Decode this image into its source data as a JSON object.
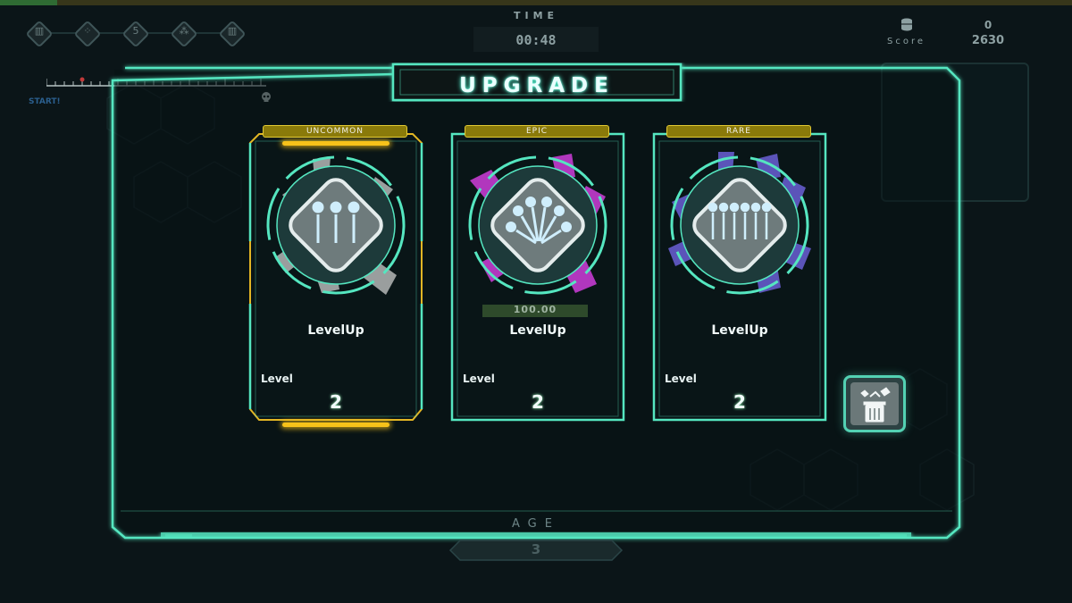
{
  "hud": {
    "time_label": "TIME",
    "time_value": "00:48",
    "coins": "0",
    "score_label": "Score",
    "score": "2630",
    "start_label": "START!",
    "skill_slots": [
      {
        "icon": "slot-icon-1",
        "glyph": "▥"
      },
      {
        "icon": "slot-icon-2",
        "glyph": "⁘"
      },
      {
        "icon": "slot-icon-3",
        "glyph": "5"
      },
      {
        "icon": "slot-icon-4",
        "glyph": "⁂"
      },
      {
        "icon": "slot-icon-5",
        "glyph": "▥"
      }
    ],
    "age_label": "AGE",
    "age_value": "3"
  },
  "dialog": {
    "title": "UPGRADE",
    "cards": [
      {
        "rarity": "UNCOMMON",
        "name": "LevelUp",
        "level_label": "Level",
        "level": "2",
        "rarity_color": "#d8d8d8",
        "selected": true
      },
      {
        "rarity": "EPIC",
        "name": "LevelUp",
        "level_label": "Level",
        "level": "2",
        "rarity_color": "#c43bd0",
        "selected": false,
        "bar_text": "100.00"
      },
      {
        "rarity": "RARE",
        "name": "LevelUp",
        "level_label": "Level",
        "level": "2",
        "rarity_color": "#6a5fd6",
        "selected": false
      }
    ],
    "reroll_icon": "reroll-trash-icon"
  },
  "colors": {
    "accent": "#55e6c0",
    "gold": "#e2c933",
    "epic": "#c43bd0",
    "rare": "#6a5fd6",
    "uncommon": "#d8d8d8"
  }
}
